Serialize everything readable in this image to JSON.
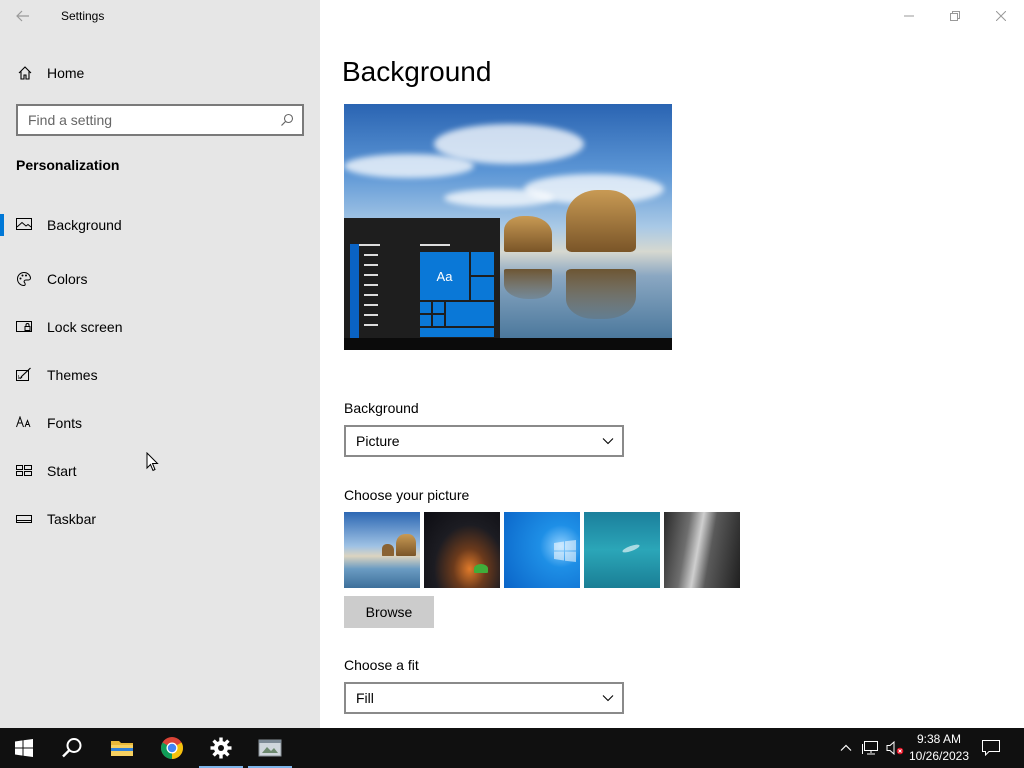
{
  "window": {
    "title": "Settings"
  },
  "sidebar": {
    "home_label": "Home",
    "search_placeholder": "Find a setting",
    "section_title": "Personalization",
    "items": [
      {
        "label": "Background",
        "icon": "picture-icon",
        "active": true
      },
      {
        "label": "Colors",
        "icon": "palette-icon",
        "active": false
      },
      {
        "label": "Lock screen",
        "icon": "lock-screen-icon",
        "active": false
      },
      {
        "label": "Themes",
        "icon": "themes-icon",
        "active": false
      },
      {
        "label": "Fonts",
        "icon": "fonts-icon",
        "active": false
      },
      {
        "label": "Start",
        "icon": "start-icon",
        "active": false
      },
      {
        "label": "Taskbar",
        "icon": "taskbar-icon",
        "active": false
      }
    ]
  },
  "main": {
    "title": "Background",
    "preview_tile_text": "Aa",
    "background_label": "Background",
    "background_value": "Picture",
    "choose_picture_label": "Choose your picture",
    "browse_label": "Browse",
    "choose_fit_label": "Choose a fit",
    "fit_value": "Fill"
  },
  "taskbar": {
    "time": "9:38 AM",
    "date": "10/26/2023",
    "apps": [
      "start-icon",
      "search-icon",
      "file-explorer-icon",
      "chrome-icon",
      "settings-icon",
      "app-icon"
    ]
  },
  "colors": {
    "accent": "#0078d7",
    "sidebar_bg": "#e6e6e6",
    "taskbar_bg": "#101010"
  }
}
